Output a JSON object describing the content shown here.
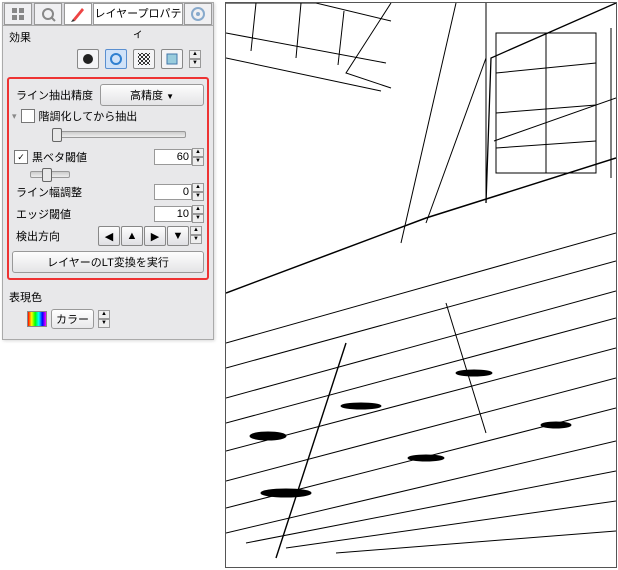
{
  "panel": {
    "title": "レイヤープロパティ",
    "section_effects": "効果",
    "section_color": "表現色"
  },
  "line": {
    "precision_label": "ライン抽出精度",
    "precision_value": "高精度",
    "posterize_label": "階調化してから抽出",
    "black_threshold_label": "黒ベタ閾値",
    "black_threshold_value": "60",
    "line_width_label": "ライン幅調整",
    "line_width_value": "0",
    "edge_threshold_label": "エッジ閾値",
    "edge_threshold_value": "10",
    "direction_label": "検出方向",
    "execute": "レイヤーのLT変換を実行"
  },
  "color": {
    "mode": "カラー"
  }
}
